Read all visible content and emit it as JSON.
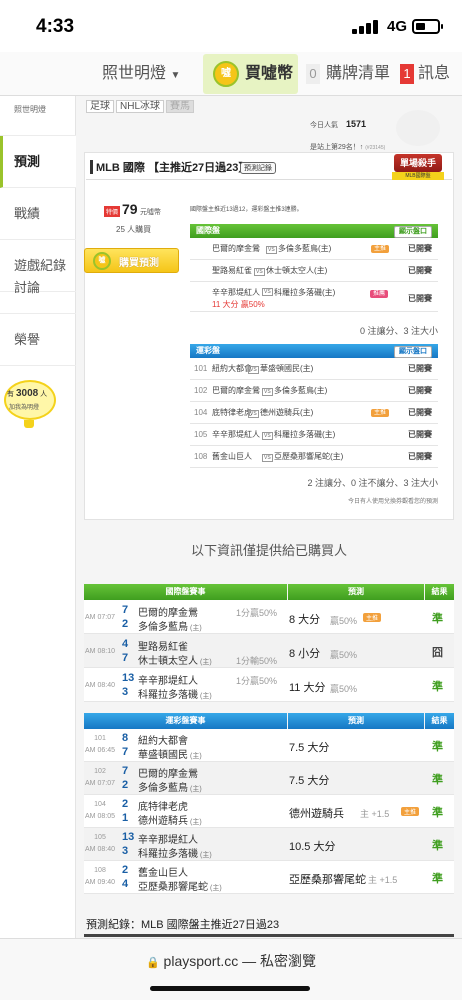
{
  "status": {
    "time": "4:33",
    "network": "4G"
  },
  "nav": {
    "site": "照世明燈",
    "buy": "買噓幣",
    "cart_count": "0",
    "cart": "購牌清單",
    "msg_count": "1",
    "msg": "訊息"
  },
  "side": {
    "header": "照世明燈",
    "items": [
      "預測",
      "戰績",
      "遊戲紀錄",
      "討論",
      "榮譽"
    ],
    "lights_prefix": "有",
    "lights_count": "3008",
    "lights_unit": "人",
    "lights_text": "加我為明燈"
  },
  "top_tabs": [
    "足球",
    "NHL冰球",
    "賽馬"
  ],
  "stats": {
    "views_label": "今日人氣",
    "views": "1571",
    "rank_text": "是站上第29名！↑",
    "rank_tag": "(#23145)"
  },
  "card": {
    "title": "MLB 國際 【主推近27日過23】",
    "record_btn": "預測記錄",
    "ribbon": "單場殺手",
    "ribbon_sub": "MLB國際盤",
    "price_tag": "特價",
    "price": "79",
    "price_unit": "元噓幣",
    "buyers": "25 人購買",
    "buy_btn": "購買預測",
    "summary": "國際盤主推近13過12，運彩盤主推3連勝。",
    "intl_title": "國際盤",
    "show_btn": "顯示盤口",
    "status": "已開賽",
    "intl_rows": [
      {
        "t1": "巴爾的摩金鶯",
        "t2": "多倫多藍鳥(主)",
        "tag": "主推",
        "pick": ""
      },
      {
        "t1": "聖路易紅雀",
        "t2": "休士頓太空人(主)",
        "tag": "",
        "pick": ""
      },
      {
        "t1": "辛辛那堤紅人",
        "t2": "科羅拉多落磯(主)",
        "tag": "推薦",
        "pick": "11 大分 贏50%"
      }
    ],
    "intl_foot": "0 注讓分、3 注大小",
    "sport_title": "運彩盤",
    "sport_rows": [
      {
        "no": "101",
        "t1": "紐約大都會",
        "t2": "華盛頓國民(主)",
        "tag": ""
      },
      {
        "no": "102",
        "t1": "巴爾的摩金鶯",
        "t2": "多倫多藍鳥(主)",
        "tag": ""
      },
      {
        "no": "104",
        "t1": "底特律老虎",
        "t2": "德州遊騎兵(主)",
        "tag": "主推"
      },
      {
        "no": "105",
        "t1": "辛辛那堤紅人",
        "t2": "科羅拉多落磯(主)",
        "tag": ""
      },
      {
        "no": "108",
        "t1": "舊金山巨人",
        "t2": "亞歷桑那響尾蛇(主)",
        "tag": ""
      }
    ],
    "sport_foot": "2 注讓分、0 注不讓分、3 注大小",
    "note": "今日有人使用兌換券觀看您的預測"
  },
  "buyers_only": "以下資訊僅提供給已購買人",
  "intl_table": {
    "hdr_game": "國際盤賽事",
    "hdr_pick": "預測",
    "hdr_res": "結果",
    "rows": [
      {
        "time": "AM 07:07",
        "n1": "7",
        "t1": "巴爾的摩金鶯",
        "n2": "2",
        "t2": "多倫多藍鳥",
        "h": "主",
        "line": "1分贏50%",
        "pick": "8 大分",
        "odds": "贏50%",
        "tag": "主推",
        "res": "準"
      },
      {
        "time": "AM 08:10",
        "n1": "4",
        "t1": "聖路易紅雀",
        "n2": "7",
        "t2": "休士頓太空人",
        "h": "主",
        "line": "1分輸50%",
        "pick": "8 小分",
        "odds": "贏50%",
        "tag": "",
        "res": "囧"
      },
      {
        "time": "AM 08:40",
        "n1": "13",
        "t1": "辛辛那堤紅人",
        "n2": "3",
        "t2": "科羅拉多落磯",
        "h": "主",
        "line": "1分贏50%",
        "pick": "11 大分",
        "odds": "贏50%",
        "tag": "",
        "res": "準"
      }
    ]
  },
  "sport_table": {
    "hdr_game": "運彩盤賽事",
    "hdr_pick": "預測",
    "hdr_res": "結果",
    "rows": [
      {
        "no": "101",
        "time": "AM 06:45",
        "n1": "8",
        "t1": "紐約大都會",
        "n2": "7",
        "t2": "華盛頓國民",
        "h": "主",
        "pick": "7.5 大分",
        "extra": "",
        "tag": "",
        "res": "準"
      },
      {
        "no": "102",
        "time": "AM 07:07",
        "n1": "7",
        "t1": "巴爾的摩金鶯",
        "n2": "2",
        "t2": "多倫多藍鳥",
        "h": "主",
        "pick": "7.5 大分",
        "extra": "",
        "tag": "",
        "res": "準"
      },
      {
        "no": "104",
        "time": "AM 08:05",
        "n1": "2",
        "t1": "底特律老虎",
        "n2": "1",
        "t2": "德州遊騎兵",
        "h": "主",
        "pick": "德州遊騎兵",
        "extra": "主 +1.5",
        "tag": "主推",
        "res": "準"
      },
      {
        "no": "105",
        "time": "AM 08:40",
        "n1": "13",
        "t1": "辛辛那堤紅人",
        "n2": "3",
        "t2": "科羅拉多落磯",
        "h": "主",
        "pick": "10.5 大分",
        "extra": "",
        "tag": "",
        "res": "準"
      },
      {
        "no": "108",
        "time": "AM 09:40",
        "n1": "2",
        "t1": "舊金山巨人",
        "n2": "4",
        "t2": "亞歷桑那響尾蛇",
        "h": "主",
        "pick": "亞歷桑那響尾蛇",
        "extra": "主 +1.5",
        "tag": "",
        "res": "準"
      }
    ]
  },
  "record_title": "預測紀錄：MLB 國際盤主推近27日過23",
  "url": "playsport.cc — 私密瀏覽"
}
